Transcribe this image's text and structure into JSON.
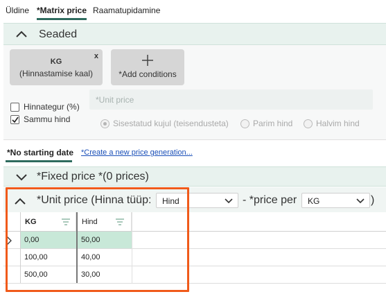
{
  "tabs": [
    {
      "label": "Üldine"
    },
    {
      "label": "*Matrix price"
    },
    {
      "label": "Raamatupidamine"
    }
  ],
  "seaded": {
    "title": "Seaded",
    "kg_card": {
      "title": "KG",
      "subtitle": "(Hinnastamise kaal)",
      "close": "x"
    },
    "add_card": {
      "label": "*Add conditions"
    },
    "unit_price_placeholder": "*Unit price",
    "checkboxes": [
      {
        "label": "Hinnategur (%)",
        "checked": false
      },
      {
        "label": "Sammu hind",
        "checked": true
      }
    ],
    "radios": [
      {
        "label": "Sisestatud kujul (teisendusteta)",
        "selected": true
      },
      {
        "label": "Parim hind",
        "selected": false
      },
      {
        "label": "Halvim hind",
        "selected": false
      }
    ]
  },
  "price_tab": {
    "label": "*No starting date",
    "link": "*Create a new price generation..."
  },
  "fixed_price": {
    "title": "*Fixed price *(0 prices)"
  },
  "unit_price": {
    "title": "*Unit price (Hinna tüüp:",
    "type_select": "Hind",
    "price_per_label": "- *price per",
    "per_select": "KG",
    "close_paren": ")"
  },
  "grid": {
    "columns": [
      "KG",
      "Hind"
    ],
    "rows": [
      [
        "0,00",
        "50,00"
      ],
      [
        "100,00",
        "40,00"
      ],
      [
        "500,00",
        "30,00"
      ]
    ],
    "selected_row": 0
  },
  "colors": {
    "accent": "#2e6b5e",
    "highlight": "#f05a1a",
    "selected_row": "#c8e8d8",
    "link": "#1a4fb8"
  }
}
